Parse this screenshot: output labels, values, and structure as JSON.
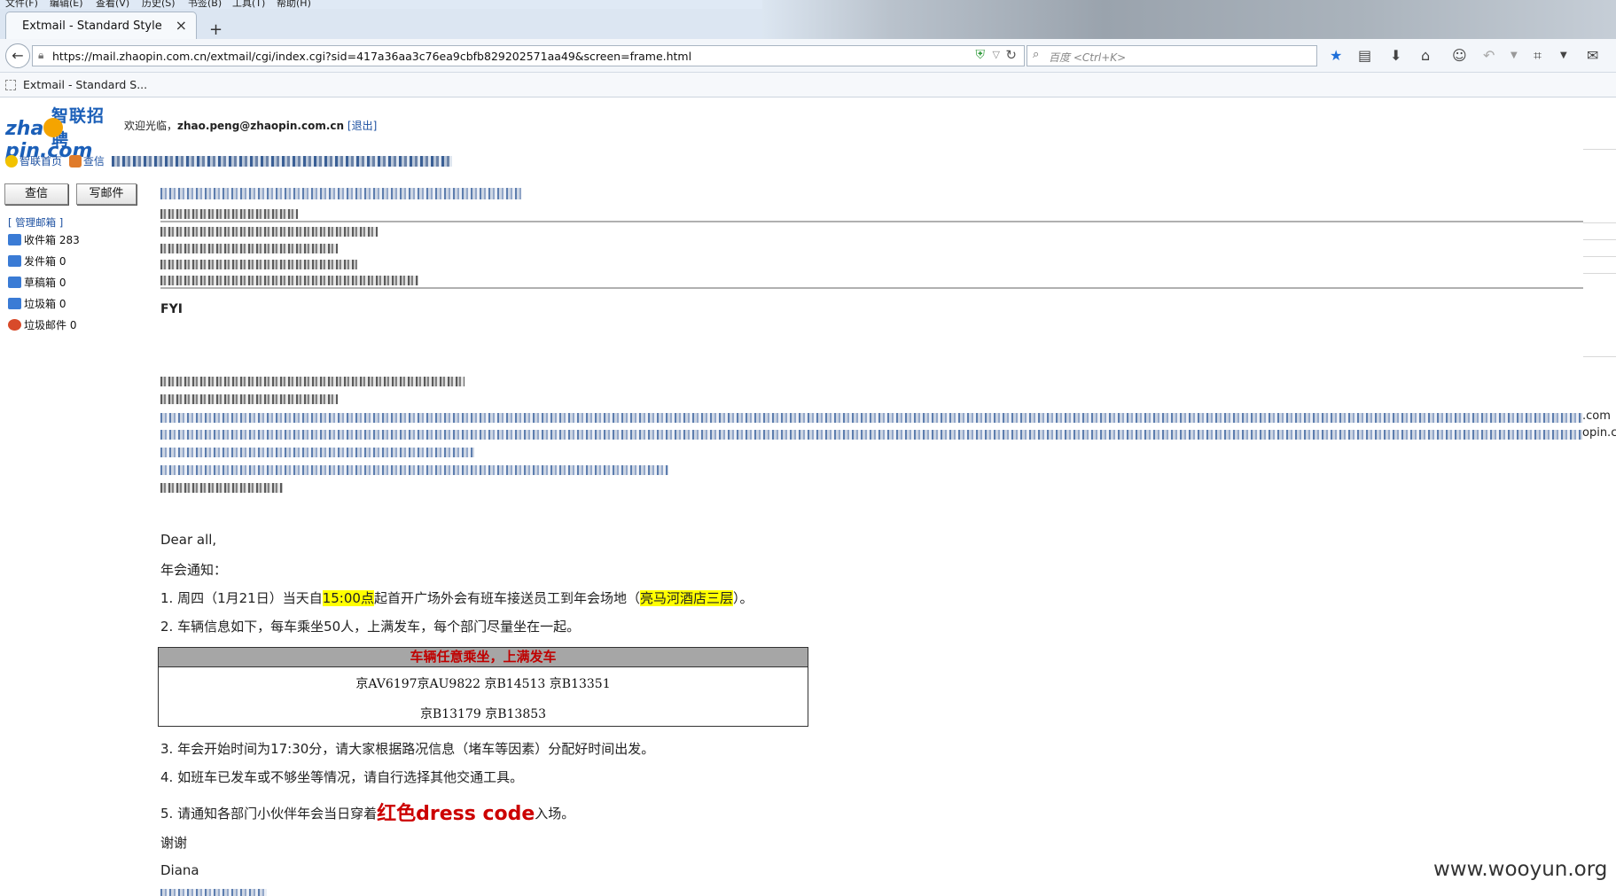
{
  "browser": {
    "menu": [
      "文件(F)",
      "编辑(E)",
      "查看(V)",
      "历史(S)",
      "书签(B)",
      "工具(T)",
      "帮助(H)"
    ],
    "tab_title": "Extmail - Standard Style",
    "tab_close": "×",
    "new_tab": "+",
    "url": "https://mail.zhaopin.com.cn/extmail/cgi/index.cgi?sid=417a36aa3c76ea9cbfb829202571aa49&screen=frame.html",
    "search_placeholder": "百度 <Ctrl+K>",
    "bookmark": "Extmail - Standard S..."
  },
  "header": {
    "logo_cn": "智联招聘",
    "logo_en_left": "zha",
    "logo_en_right": "pin.com",
    "welcome": "欢迎光临，",
    "email": "zhao.peng@zhaopin.com.cn",
    "logout_open": "[",
    "logout": "退出",
    "logout_close": "]"
  },
  "topnav": {
    "home": "智联首页",
    "check": "查信"
  },
  "sidebar": {
    "check_button": "查信",
    "compose_button": "写邮件",
    "manage": "[ 管理邮箱 ]",
    "folders": [
      {
        "label": "收件箱 283",
        "color": "#3a7bd5"
      },
      {
        "label": "发件箱 0",
        "color": "#3a7bd5"
      },
      {
        "label": "草稿箱 0",
        "color": "#3a7bd5"
      },
      {
        "label": "垃圾箱 0",
        "color": "#3a7bd5"
      },
      {
        "label": "垃圾邮件 0",
        "color": "#d84a2a"
      }
    ]
  },
  "email": {
    "fyi": "FYI",
    "greeting": "Dear all,",
    "title": "年会通知：",
    "item1_pre": "1.  周四（1月21日）当天自",
    "item1_time": "15:00点",
    "item1_mid": "起首开广场外会有班车接送员工到年会场地（",
    "item1_place": "亮马河酒店三层",
    "item1_end": "）。",
    "item2": "2.  车辆信息如下，每车乘坐50人，上满发车，每个部门尽量坐在一起。",
    "table_head": "车辆任意乘坐，上满发车",
    "table_row1": "京AV6197京AU9822 京B14513 京B13351",
    "table_row2": "京B13179   京B13853",
    "item3": "3.  年会开始时间为17:30分，请大家根据路况信息（堵车等因素）分配好时间出发。",
    "item4": "4.  如班车已发车或不够坐等情况，请自行选择其他交通工具。",
    "item5_pre": "5.  请通知各部门小伙伴年会当日穿着",
    "item5_red": "红色dress code",
    "item5_end": "入场。",
    "thanks": "谢谢",
    "sign": "Diana",
    "overflow_1": ".com",
    "overflow_2": "opin.c"
  },
  "watermark": "www.wooyun.org"
}
